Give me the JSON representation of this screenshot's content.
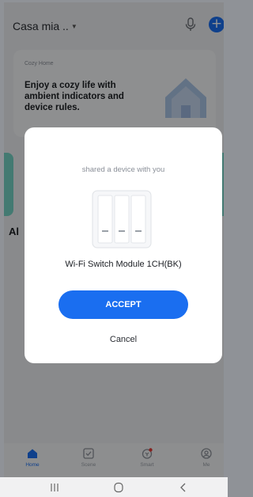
{
  "header": {
    "home_name": "Casa mia ..",
    "caret": "▼"
  },
  "banner": {
    "kicker": "Cozy Home",
    "text": "Enjoy a cozy life with ambient indicators and device rules."
  },
  "section": {
    "all_label": "Al",
    "right_label": "-"
  },
  "dialog": {
    "message": "shared a device with you",
    "device_name": "Wi-Fi Switch Module 1CH(BK)",
    "accept_label": "ACCEPT",
    "cancel_label": "Cancel"
  },
  "tabs": [
    {
      "label": "Home",
      "icon": "home-icon",
      "active": true
    },
    {
      "label": "Scene",
      "icon": "scene-icon",
      "active": false
    },
    {
      "label": "Smart",
      "icon": "smart-icon",
      "active": false
    },
    {
      "label": "Me",
      "icon": "me-icon",
      "active": false
    }
  ],
  "colors": {
    "accent": "#1a6ef0",
    "tile": "#74d3c5",
    "badge": "#e53935"
  }
}
